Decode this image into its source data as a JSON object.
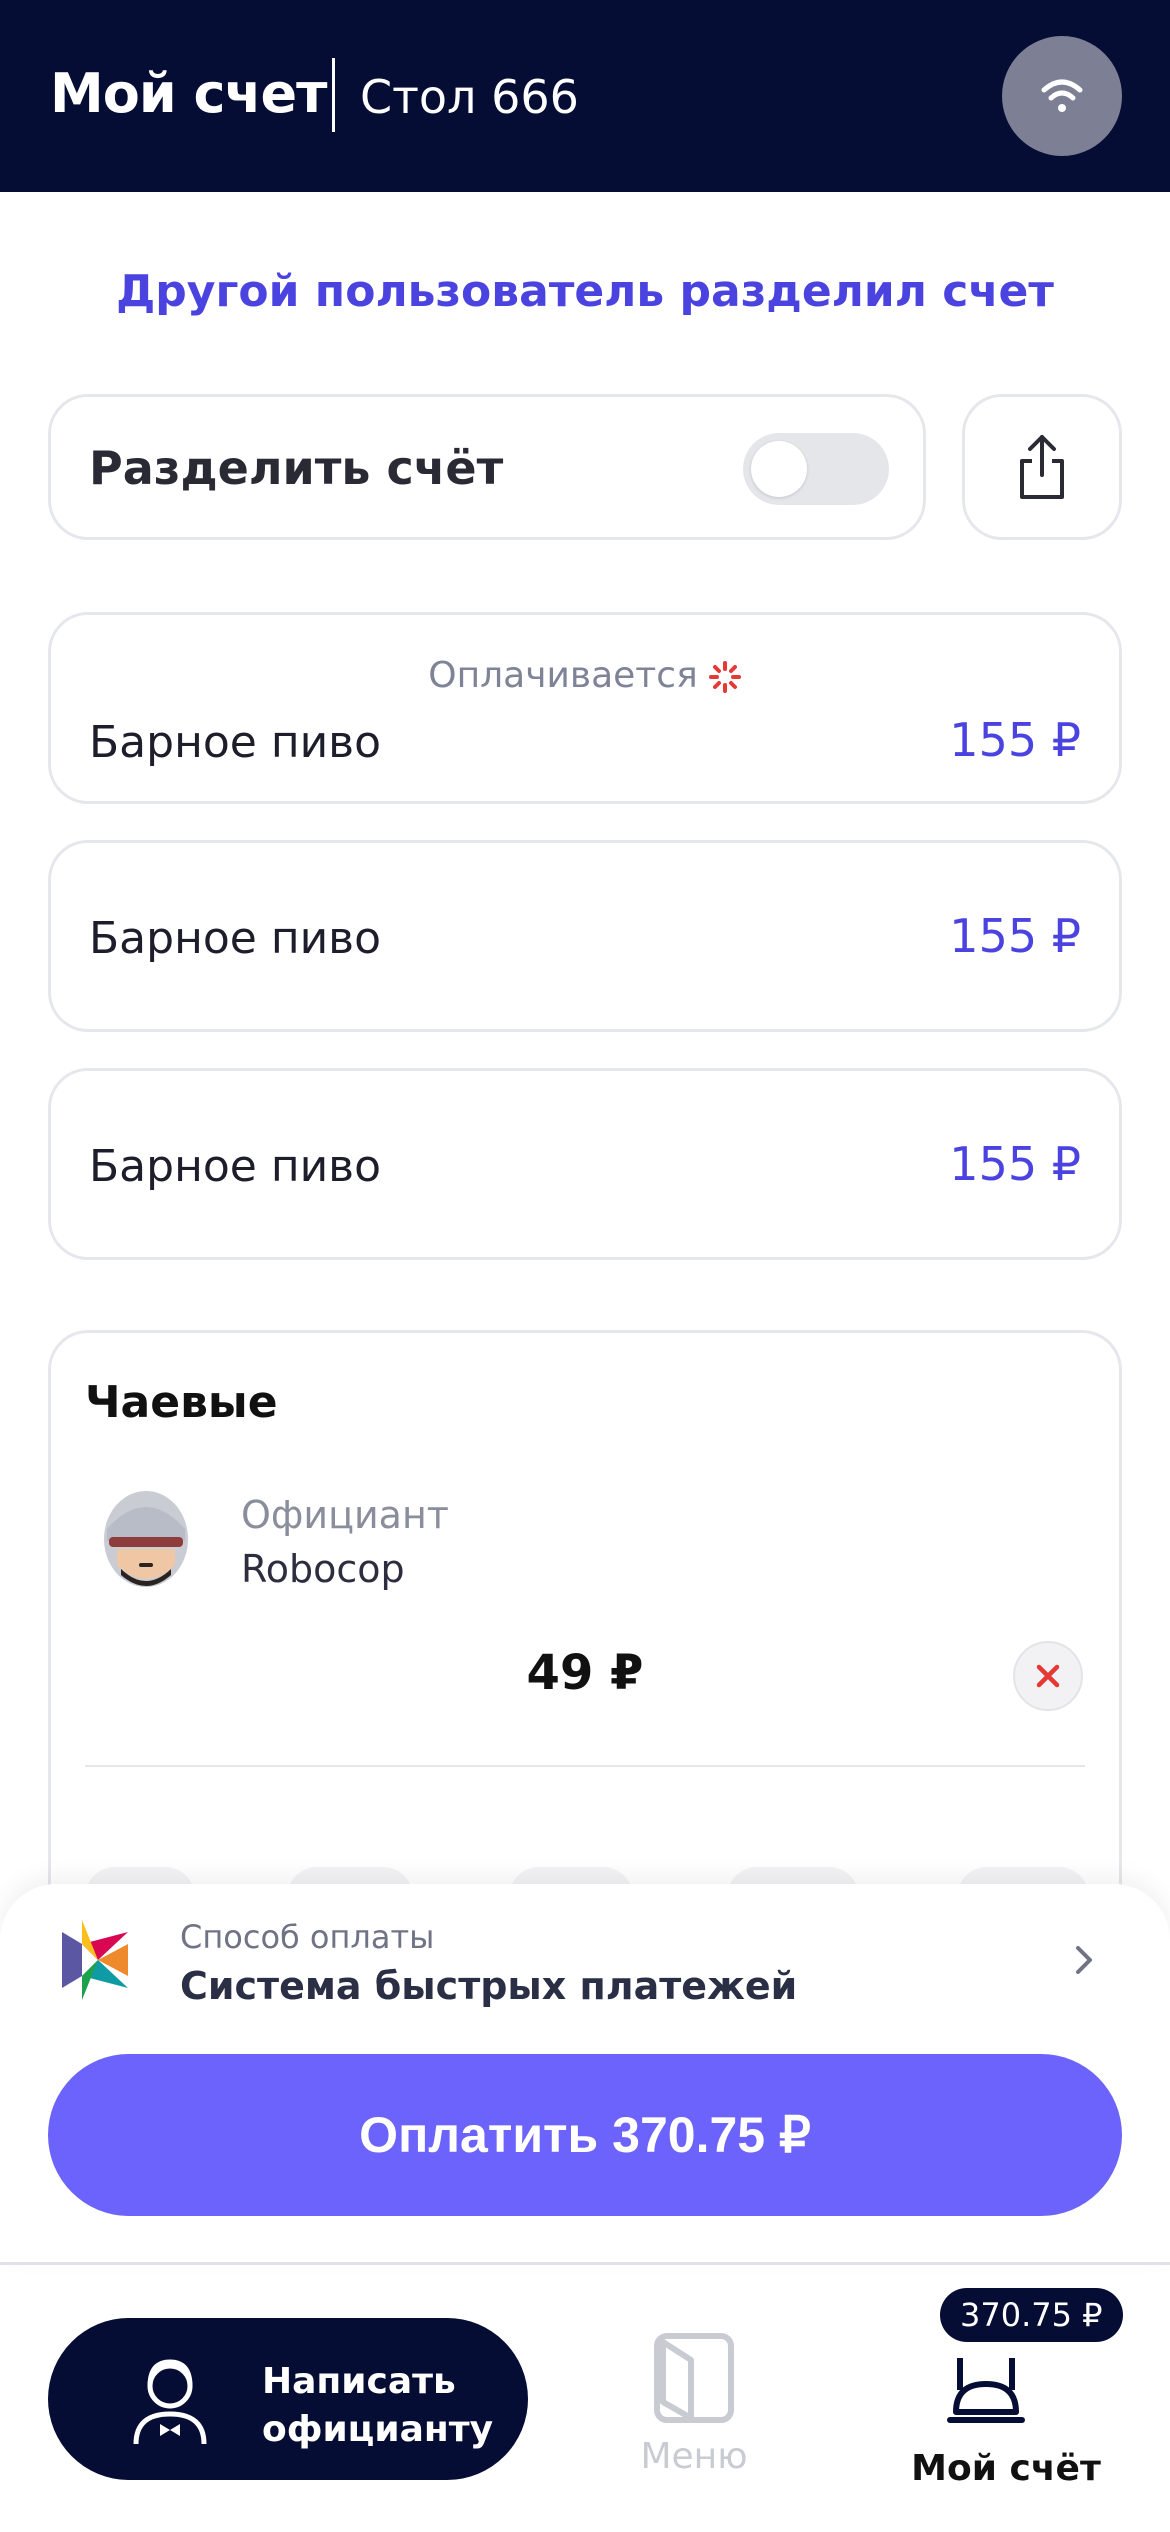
{
  "header": {
    "title": "Мой счет",
    "table": "Стол 666",
    "wifi_icon": "wifi-icon"
  },
  "notice": "Другой пользователь разделил счет",
  "split": {
    "label": "Разделить счёт",
    "toggle_on": false,
    "share_icon": "share-icon"
  },
  "items": [
    {
      "name": "Барное пиво",
      "price": "155 ₽",
      "status": "Оплачивается"
    },
    {
      "name": "Барное пиво",
      "price": "155 ₽"
    },
    {
      "name": "Барное пиво",
      "price": "155 ₽"
    }
  ],
  "tips": {
    "heading": "Чаевые",
    "role": "Официант",
    "waiter_name": "Robocop",
    "amount": "49 ₽"
  },
  "payment": {
    "label": "Способ оплаты",
    "method": "Система быстрых платежей",
    "pay_button": "Оплатить 370.75 ₽"
  },
  "tabbar": {
    "write_waiter_line1": "Написать",
    "write_waiter_line2": "официанту",
    "menu": "Меню",
    "my_bill": "Мой счёт",
    "bill_badge": "370.75 ₽"
  },
  "colors": {
    "header_bg": "#050d35",
    "accent": "#4a43e0",
    "pay_button": "#6b63fb",
    "remove": "#e53935"
  }
}
